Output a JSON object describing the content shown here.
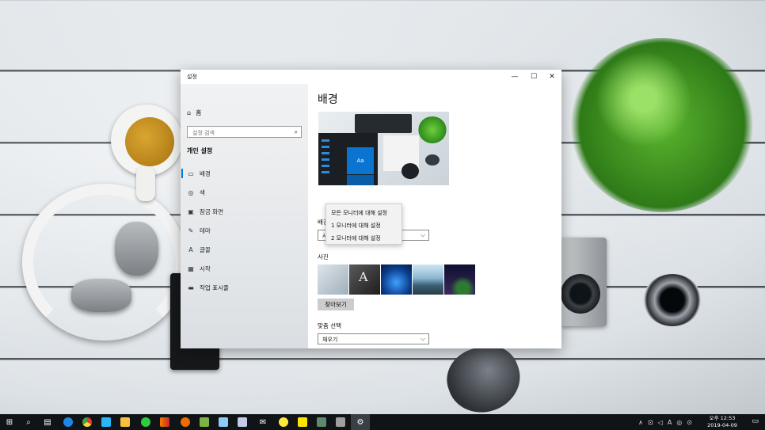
{
  "window": {
    "title": "설정",
    "controls": {
      "minimize": "—",
      "maximize": "☐",
      "close": "✕"
    }
  },
  "sidebar": {
    "home_icon": "home-icon",
    "home_label": "홈",
    "search_placeholder": "설정 검색",
    "section_title": "개인 설정",
    "items": [
      {
        "label": "배경",
        "icon": "picture-icon",
        "active": true
      },
      {
        "label": "색",
        "icon": "palette-icon",
        "active": false
      },
      {
        "label": "잠금 화면",
        "icon": "lock-screen-icon",
        "active": false
      },
      {
        "label": "테마",
        "icon": "brush-icon",
        "active": false
      },
      {
        "label": "글꼴",
        "icon": "font-icon",
        "active": false
      },
      {
        "label": "시작",
        "icon": "start-icon",
        "active": false
      },
      {
        "label": "작업 표시줄",
        "icon": "taskbar-icon",
        "active": false
      }
    ]
  },
  "content": {
    "page_title": "배경",
    "preview_tile_text": "Aa",
    "background_label": "배경",
    "background_value": "사",
    "picture_label": "사진",
    "browse_button": "찾아보기",
    "fit_label": "맞춤 선택",
    "fit_value": "채우기",
    "context_menu": [
      "모든 모니터에 대해 설정",
      "1 모니터에 대해 설정",
      "2 모니터에 대해 설정"
    ],
    "thumb2_letter": "A"
  },
  "taskbar": {
    "time": "오후 12:53",
    "date": "2019-04-09",
    "apps": [
      "start",
      "search",
      "task-view",
      "edge",
      "chrome",
      "app-blue",
      "file-explorer",
      "line",
      "winamp",
      "app-orange",
      "app-green",
      "app-docs",
      "app-tools",
      "mail",
      "app-yellow",
      "kakaotalk",
      "app-photo",
      "app-gray",
      "settings"
    ],
    "accent": "#0078d7"
  }
}
